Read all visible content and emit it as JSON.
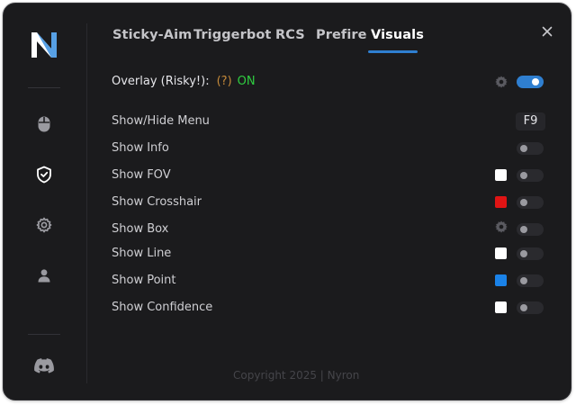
{
  "colors": {
    "accent": "#2f7fd0",
    "window_bg": "#1b1b1d",
    "on_green": "#2fcc40",
    "question_orange": "#c58a3a"
  },
  "sidebar": {
    "logo": "nyron-logo",
    "items": [
      {
        "icon": "mouse-icon"
      },
      {
        "icon": "shield-check-icon"
      },
      {
        "icon": "gear-icon"
      },
      {
        "icon": "user-icon"
      },
      {
        "icon": "discord-icon"
      }
    ]
  },
  "tabs": [
    {
      "label": "Sticky-Aim",
      "active": false
    },
    {
      "label": "Triggerbot",
      "active": false
    },
    {
      "label": "RCS",
      "active": false
    },
    {
      "label": "Prefire",
      "active": false
    },
    {
      "label": "Visuals",
      "active": true
    }
  ],
  "overlay": {
    "label": "Overlay (Risky!):",
    "hint": "(?)",
    "status": "ON",
    "enabled": true
  },
  "options": [
    {
      "label": "Show/Hide Menu",
      "key": "F9"
    },
    {
      "label": "Show Info",
      "enabled": false
    },
    {
      "label": "Show FOV",
      "color": "#ffffff",
      "enabled": false
    },
    {
      "label": "Show Crosshair",
      "color": "#e01414",
      "enabled": false
    },
    {
      "label": "Show Box",
      "has_settings": true,
      "enabled": false
    },
    {
      "label": "Show Line",
      "color": "#ffffff",
      "enabled": false
    },
    {
      "label": "Show Point",
      "color": "#1a82e8",
      "enabled": false
    },
    {
      "label": "Show Confidence",
      "color": "#ffffff",
      "enabled": false
    }
  ],
  "footer": {
    "copyright": "Copyright 2025 | Nyron"
  }
}
